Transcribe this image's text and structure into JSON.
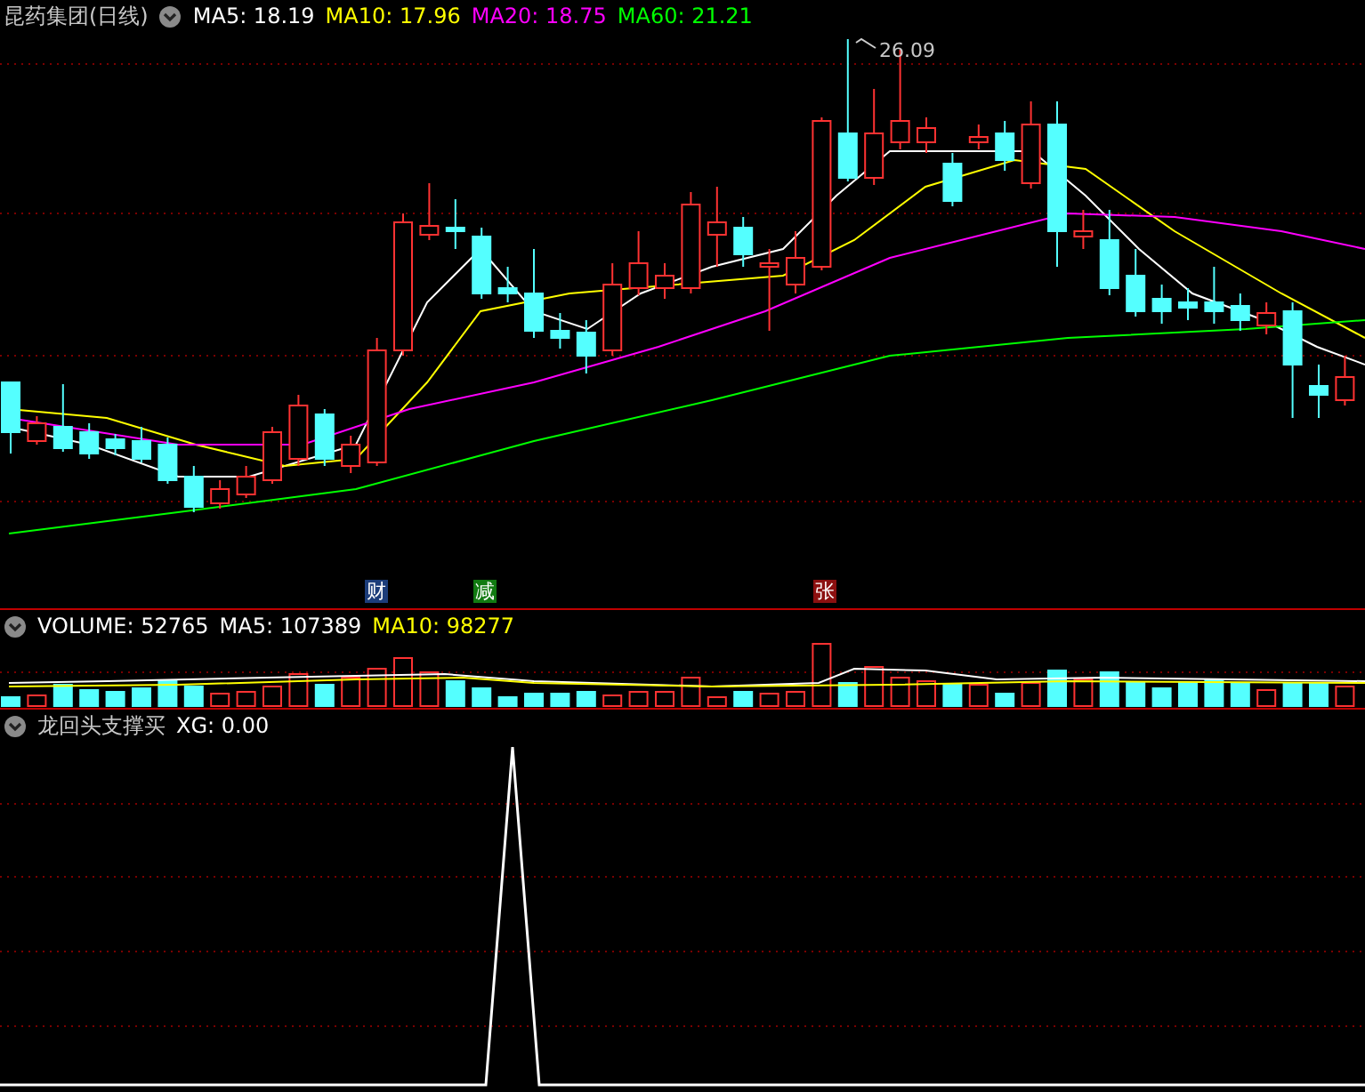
{
  "main_pane": {
    "title": "昆药集团(日线)",
    "indicators": [
      {
        "text": "MA5: 18.19",
        "color": "#ffffff"
      },
      {
        "text": "MA10: 17.96",
        "color": "#ffff00"
      },
      {
        "text": "MA20: 18.75",
        "color": "#ff00ff"
      },
      {
        "text": "MA60: 21.21",
        "color": "#00ff00"
      }
    ],
    "peak_label": "26.09",
    "event_markers": [
      {
        "label": "财",
        "color": "#1c3d7a"
      },
      {
        "label": "减",
        "color": "#117a11"
      },
      {
        "label": "张",
        "color": "#8c1010"
      }
    ]
  },
  "volume_pane": {
    "indicators": [
      {
        "text": "VOLUME: 52765",
        "color": "#ffffff"
      },
      {
        "text": "MA5: 107389",
        "color": "#ffffff"
      },
      {
        "text": "MA10: 98277",
        "color": "#ffff00"
      }
    ]
  },
  "signal_pane": {
    "title": "龙回头支撑买",
    "indicators": [
      {
        "text": "XG: 0.00",
        "color": "#ffffff"
      }
    ]
  }
}
